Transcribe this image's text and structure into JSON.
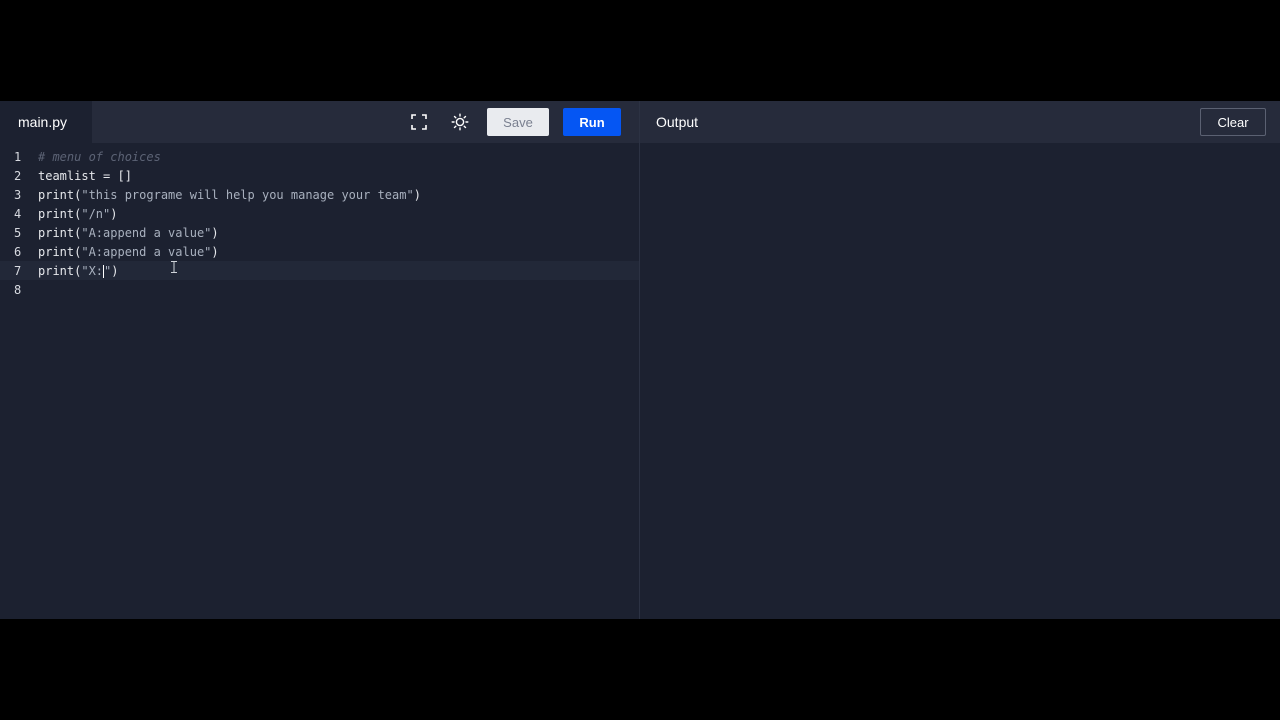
{
  "editor": {
    "file_tab": "main.py",
    "icons": {
      "fullscreen": "fullscreen-icon",
      "theme": "brightness-icon"
    },
    "save_label": "Save",
    "run_label": "Run",
    "lines": [
      {
        "number": "1",
        "tokens": [
          {
            "type": "comment",
            "text": "# menu of choices"
          }
        ]
      },
      {
        "number": "2",
        "tokens": [
          {
            "type": "plain",
            "text": "teamlist = []"
          }
        ]
      },
      {
        "number": "3",
        "tokens": [
          {
            "type": "func",
            "text": "print("
          },
          {
            "type": "str",
            "text": "\"this programe will help you manage your team\""
          },
          {
            "type": "func",
            "text": ")"
          }
        ]
      },
      {
        "number": "4",
        "tokens": [
          {
            "type": "func",
            "text": "print("
          },
          {
            "type": "str",
            "text": "\"/n\""
          },
          {
            "type": "func",
            "text": ")"
          }
        ]
      },
      {
        "number": "5",
        "tokens": [
          {
            "type": "func",
            "text": "print("
          },
          {
            "type": "str",
            "text": "\"A:append a value\""
          },
          {
            "type": "func",
            "text": ")"
          }
        ]
      },
      {
        "number": "6",
        "tokens": [
          {
            "type": "func",
            "text": "print("
          },
          {
            "type": "str",
            "text": "\"A:append a value\""
          },
          {
            "type": "func",
            "text": ")"
          }
        ]
      },
      {
        "number": "7",
        "tokens": [
          {
            "type": "func",
            "text": "print("
          },
          {
            "type": "str",
            "text": "\"X:"
          },
          {
            "type": "caret",
            "text": ""
          },
          {
            "type": "str",
            "text": "\""
          },
          {
            "type": "func",
            "text": ")"
          }
        ],
        "active": true
      },
      {
        "number": "8",
        "tokens": []
      }
    ]
  },
  "output": {
    "title": "Output",
    "clear_label": "Clear"
  },
  "colors": {
    "run_button": "#0556f3",
    "editor_bg": "#1c2130",
    "toolbar_bg": "#262b3b"
  }
}
